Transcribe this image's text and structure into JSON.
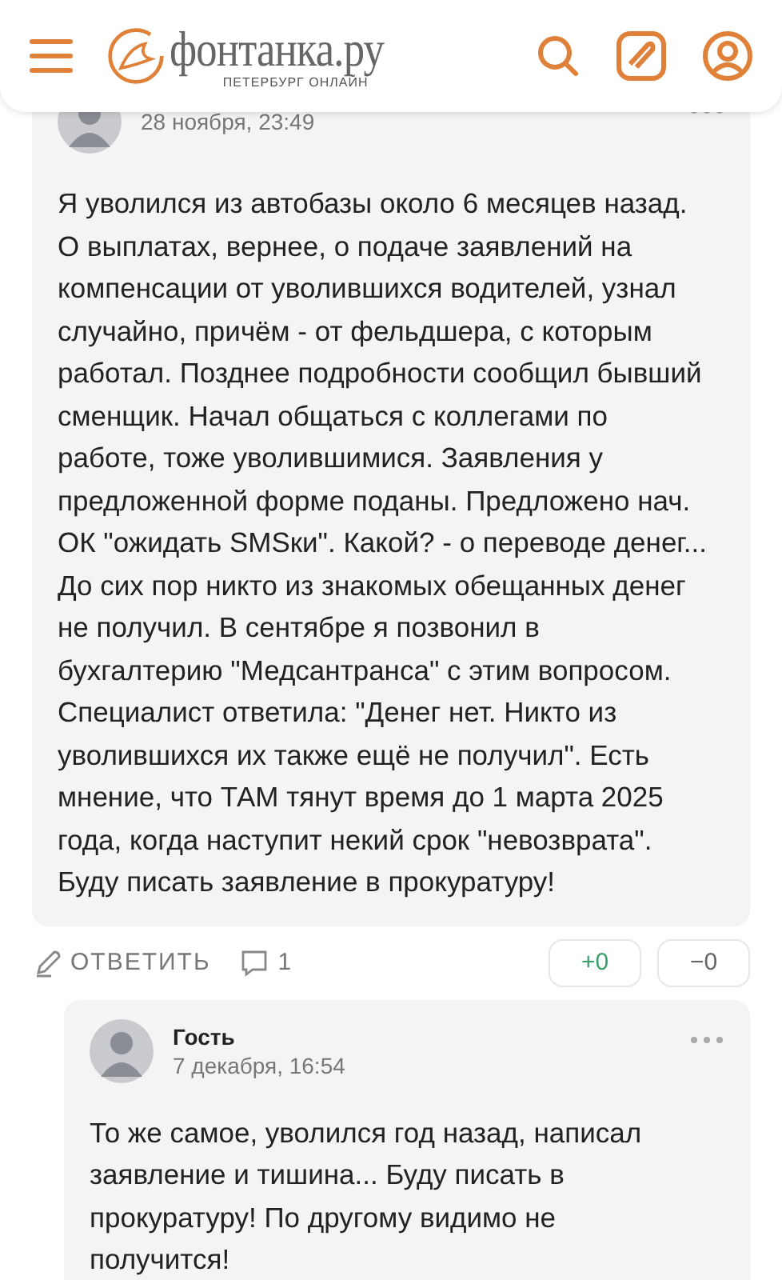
{
  "header": {
    "logo_text": "фонтанка.ру",
    "logo_subtitle": "ПЕТЕРБУРГ ОНЛАЙН"
  },
  "comments": [
    {
      "date": "28 ноября, 23:49",
      "text": "Я уволился из автобазы около 6 месяцев назад. О выплатах, вернее, о подаче заявлений на компенсации от уволившихся водителей, узнал случайно, причём - от фельдшера, с которым работал. Позднее подробности сообщил бывший сменщик. Начал общаться с коллегами по работе, тоже уволившимися. Заявления у предложенной форме поданы. Предложено нач. ОК \"ожидать SMSки\". Какой? - о переводе денег... До сих пор никто из знакомых обещанных денег не получил. В сентябре я позвонил в бухгалтерию \"Медсантранса\" с этим вопросом. Специалист ответила: \"Денег нет. Никто из уволившихся их также ещё не получил\". Есть мнение, что ТАМ тянут время до 1 марта 2025 года, когда наступит некий срок \"невозврата\". Буду писать заявление в прокуратуру!",
      "reply_label": "ОТВЕТИТЬ",
      "reply_count": "1",
      "upvotes": "+0",
      "downvotes": "−0",
      "replies": [
        {
          "author": "Гость",
          "date": "7 декабря, 16:54",
          "text": "То же самое, уволился год назад, написал заявление и тишина... Буду писать в прокуратуру! По другому видимо не получится!"
        }
      ]
    }
  ]
}
